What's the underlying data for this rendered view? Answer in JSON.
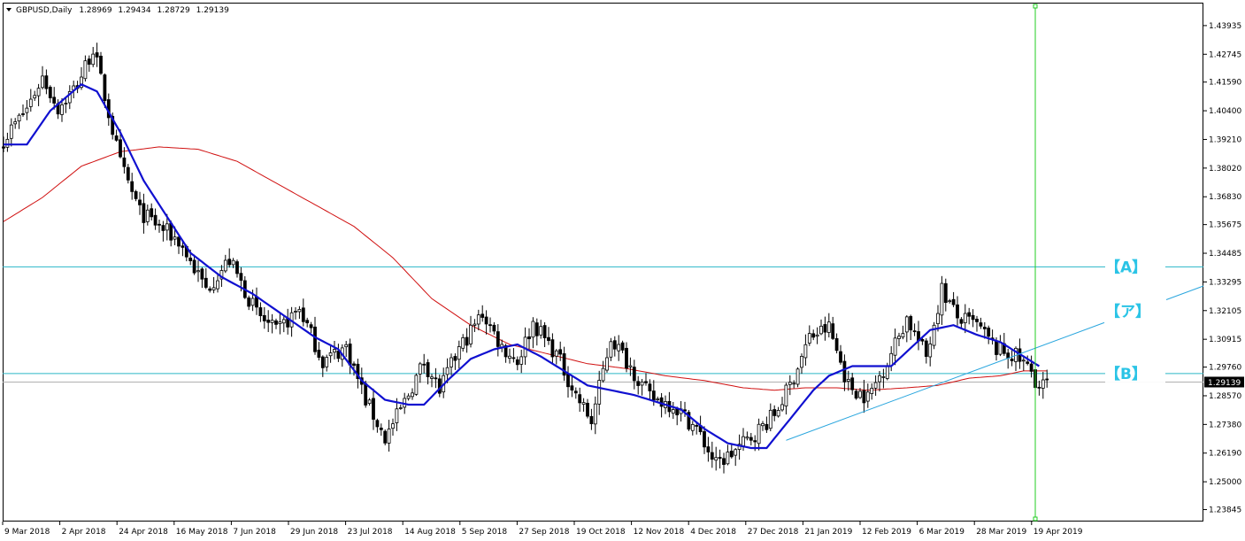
{
  "header": {
    "symbol": "GBPUSD,Daily",
    "open": "1.28969",
    "high": "1.29434",
    "low": "1.28729",
    "close": "1.29139"
  },
  "colors": {
    "background": "#ffffff",
    "candle": "#000000",
    "ma_fast": "#1010d0",
    "ma_slow": "#d01010",
    "level_line": "#2ab7c8",
    "trend_line": "#2aa6de",
    "vertical_line": "#22cc22",
    "current_price_line": "#b0b0b0",
    "label": "#2bc4e6",
    "price_tag_bg": "#000000"
  },
  "chart_data": {
    "type": "line",
    "y_axis": {
      "ylim": [
        1.2335,
        1.4485
      ],
      "ticks": [
        "1.43935",
        "1.42745",
        "1.41590",
        "1.40400",
        "1.39210",
        "1.38020",
        "1.36830",
        "1.35675",
        "1.34485",
        "1.33295",
        "1.32105",
        "1.30915",
        "1.29760",
        "1.28570",
        "1.27380",
        "1.26190",
        "1.25000",
        "1.23845"
      ],
      "current_price": "1.29139"
    },
    "x_axis": {
      "ticks": [
        "9 Mar 2018",
        "2 Apr 2018",
        "24 Apr 2018",
        "16 May 2018",
        "7 Jun 2018",
        "29 Jun 2018",
        "23 Jul 2018",
        "14 Aug 2018",
        "5 Sep 2018",
        "27 Sep 2018",
        "19 Oct 2018",
        "12 Nov 2018",
        "4 Dec 2018",
        "27 Dec 2018",
        "21 Jan 2019",
        "12 Feb 2019",
        "6 Mar 2019",
        "28 Mar 2019",
        "19 Apr 2019"
      ]
    },
    "price_anchors": [
      {
        "d": 0,
        "p": 1.392
      },
      {
        "d": 6,
        "p": 1.405
      },
      {
        "d": 10,
        "p": 1.418
      },
      {
        "d": 14,
        "p": 1.405
      },
      {
        "d": 19,
        "p": 1.415
      },
      {
        "d": 23,
        "p": 1.43
      },
      {
        "d": 26,
        "p": 1.41
      },
      {
        "d": 30,
        "p": 1.382
      },
      {
        "d": 35,
        "p": 1.362
      },
      {
        "d": 45,
        "p": 1.35
      },
      {
        "d": 52,
        "p": 1.33
      },
      {
        "d": 58,
        "p": 1.342
      },
      {
        "d": 65,
        "p": 1.32
      },
      {
        "d": 70,
        "p": 1.312
      },
      {
        "d": 76,
        "p": 1.322
      },
      {
        "d": 82,
        "p": 1.3
      },
      {
        "d": 88,
        "p": 1.306
      },
      {
        "d": 93,
        "p": 1.284
      },
      {
        "d": 98,
        "p": 1.268
      },
      {
        "d": 103,
        "p": 1.283
      },
      {
        "d": 108,
        "p": 1.3
      },
      {
        "d": 112,
        "p": 1.288
      },
      {
        "d": 117,
        "p": 1.305
      },
      {
        "d": 123,
        "p": 1.32
      },
      {
        "d": 128,
        "p": 1.306
      },
      {
        "d": 132,
        "p": 1.3
      },
      {
        "d": 136,
        "p": 1.316
      },
      {
        "d": 142,
        "p": 1.303
      },
      {
        "d": 147,
        "p": 1.286
      },
      {
        "d": 151,
        "p": 1.275
      },
      {
        "d": 156,
        "p": 1.31
      },
      {
        "d": 161,
        "p": 1.298
      },
      {
        "d": 166,
        "p": 1.285
      },
      {
        "d": 172,
        "p": 1.282
      },
      {
        "d": 178,
        "p": 1.272
      },
      {
        "d": 183,
        "p": 1.257
      },
      {
        "d": 188,
        "p": 1.263
      },
      {
        "d": 193,
        "p": 1.27
      },
      {
        "d": 198,
        "p": 1.278
      },
      {
        "d": 202,
        "p": 1.29
      },
      {
        "d": 207,
        "p": 1.31
      },
      {
        "d": 212,
        "p": 1.314
      },
      {
        "d": 217,
        "p": 1.29
      },
      {
        "d": 222,
        "p": 1.285
      },
      {
        "d": 227,
        "p": 1.3
      },
      {
        "d": 232,
        "p": 1.318
      },
      {
        "d": 237,
        "p": 1.302
      },
      {
        "d": 241,
        "p": 1.33
      },
      {
        "d": 245,
        "p": 1.318
      },
      {
        "d": 250,
        "p": 1.315
      },
      {
        "d": 255,
        "p": 1.305
      },
      {
        "d": 260,
        "p": 1.302
      },
      {
        "d": 264,
        "p": 1.296
      },
      {
        "d": 266,
        "p": 1.289
      },
      {
        "d": 268,
        "p": 1.291
      }
    ],
    "ma_fast_points": [
      [
        0,
        1.39
      ],
      [
        6,
        1.39
      ],
      [
        12,
        1.404
      ],
      [
        20,
        1.415
      ],
      [
        24,
        1.412
      ],
      [
        30,
        1.395
      ],
      [
        36,
        1.375
      ],
      [
        42,
        1.36
      ],
      [
        48,
        1.345
      ],
      [
        56,
        1.335
      ],
      [
        64,
        1.328
      ],
      [
        72,
        1.319
      ],
      [
        80,
        1.31
      ],
      [
        86,
        1.305
      ],
      [
        92,
        1.292
      ],
      [
        98,
        1.284
      ],
      [
        104,
        1.282
      ],
      [
        108,
        1.282
      ],
      [
        114,
        1.292
      ],
      [
        120,
        1.301
      ],
      [
        126,
        1.305
      ],
      [
        132,
        1.307
      ],
      [
        138,
        1.302
      ],
      [
        144,
        1.296
      ],
      [
        150,
        1.29
      ],
      [
        156,
        1.288
      ],
      [
        162,
        1.286
      ],
      [
        168,
        1.283
      ],
      [
        174,
        1.28
      ],
      [
        180,
        1.272
      ],
      [
        186,
        1.266
      ],
      [
        192,
        1.264
      ],
      [
        196,
        1.264
      ],
      [
        202,
        1.276
      ],
      [
        208,
        1.288
      ],
      [
        212,
        1.294
      ],
      [
        218,
        1.298
      ],
      [
        222,
        1.298
      ],
      [
        228,
        1.298
      ],
      [
        234,
        1.307
      ],
      [
        238,
        1.313
      ],
      [
        244,
        1.315
      ],
      [
        250,
        1.311
      ],
      [
        256,
        1.308
      ],
      [
        262,
        1.302
      ],
      [
        266,
        1.298
      ]
    ],
    "ma_slow_points": [
      [
        0,
        1.358
      ],
      [
        10,
        1.368
      ],
      [
        20,
        1.381
      ],
      [
        30,
        1.387
      ],
      [
        40,
        1.389
      ],
      [
        50,
        1.388
      ],
      [
        60,
        1.383
      ],
      [
        70,
        1.374
      ],
      [
        80,
        1.365
      ],
      [
        90,
        1.356
      ],
      [
        100,
        1.343
      ],
      [
        110,
        1.326
      ],
      [
        120,
        1.315
      ],
      [
        130,
        1.307
      ],
      [
        140,
        1.303
      ],
      [
        150,
        1.299
      ],
      [
        160,
        1.297
      ],
      [
        170,
        1.294
      ],
      [
        180,
        1.292
      ],
      [
        190,
        1.289
      ],
      [
        198,
        1.288
      ],
      [
        206,
        1.289
      ],
      [
        214,
        1.289
      ],
      [
        222,
        1.288
      ],
      [
        232,
        1.289
      ],
      [
        240,
        1.29
      ],
      [
        248,
        1.293
      ],
      [
        256,
        1.294
      ],
      [
        262,
        1.296
      ],
      [
        268,
        1.296
      ]
    ],
    "levels": [
      {
        "name": "A",
        "price": 1.3392
      },
      {
        "name": "B",
        "price": 1.2949
      }
    ],
    "trend_line": {
      "d1": 201,
      "p1": 1.2672,
      "d2": 290,
      "p2": 1.3204
    },
    "vertical_line_day": 265,
    "labels": [
      {
        "text": "【A】",
        "attach": "A"
      },
      {
        "text": "【ア】",
        "attach": "trend"
      },
      {
        "text": "【B】",
        "attach": "B"
      }
    ]
  }
}
